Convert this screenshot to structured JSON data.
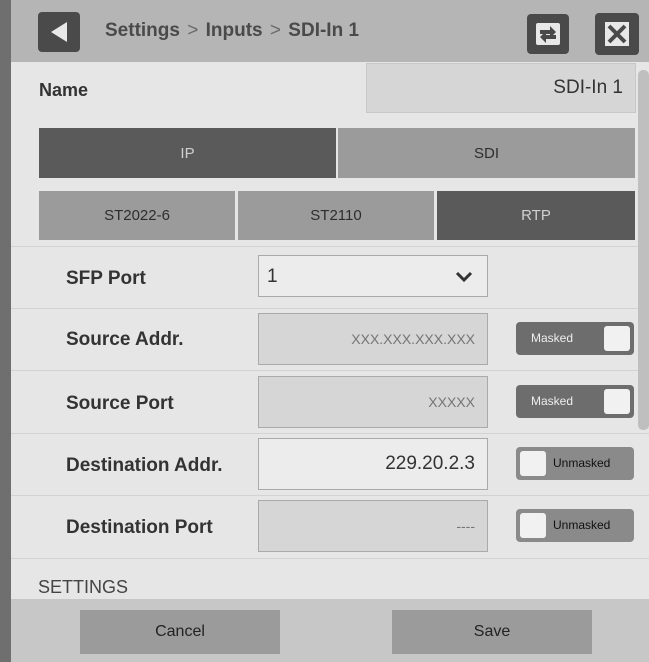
{
  "header": {
    "breadcrumb": [
      "Settings",
      "Inputs",
      "SDI-In 1"
    ],
    "separator": ">"
  },
  "name_field": {
    "label": "Name",
    "value": "SDI-In 1"
  },
  "input_type": {
    "options": [
      "IP",
      "SDI"
    ],
    "selected": "IP"
  },
  "ip_standard": {
    "options": [
      "ST2022-6",
      "ST2110",
      "RTP"
    ],
    "selected": "RTP"
  },
  "fields": {
    "sfp_port": {
      "label": "SFP Port",
      "value": "1"
    },
    "source_addr": {
      "label": "Source Addr.",
      "placeholder": "XXX.XXX.XXX.XXX",
      "toggle": "Masked"
    },
    "source_port": {
      "label": "Source Port",
      "placeholder": "XXXXX",
      "toggle": "Masked"
    },
    "dest_addr": {
      "label": "Destination Addr.",
      "value": "229.20.2.3",
      "toggle": "Unmasked"
    },
    "dest_port": {
      "label": "Destination Port",
      "placeholder": "----",
      "toggle": "Unmasked"
    }
  },
  "section": {
    "title": "SETTINGS"
  },
  "footer": {
    "cancel": "Cancel",
    "save": "Save"
  },
  "icons": {
    "back": "back-arrow-icon",
    "swap": "swap-arrows-icon",
    "close": "close-x-icon",
    "dropdown": "chevron-down-icon"
  },
  "colors": {
    "active_segment": "#5a5a5a",
    "inactive_segment": "#9b9b9b",
    "titlebar": "#b5b5b5"
  }
}
